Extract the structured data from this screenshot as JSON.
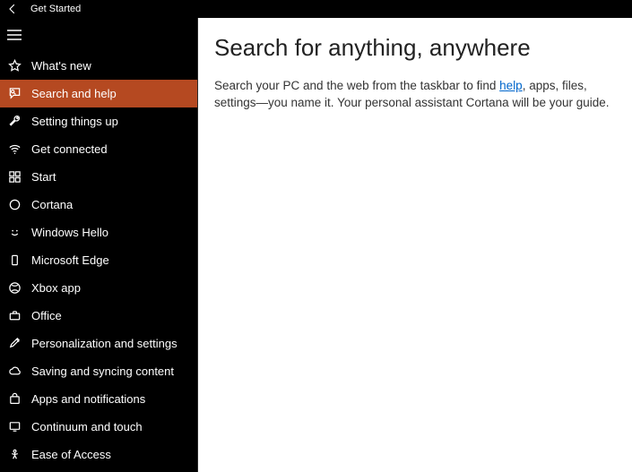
{
  "titlebar": {
    "title": "Get Started"
  },
  "sidebar": {
    "items": [
      {
        "label": "What's new"
      },
      {
        "label": "Search and help"
      },
      {
        "label": "Setting things up"
      },
      {
        "label": "Get connected"
      },
      {
        "label": "Start"
      },
      {
        "label": "Cortana"
      },
      {
        "label": "Windows Hello"
      },
      {
        "label": "Microsoft Edge"
      },
      {
        "label": "Xbox app"
      },
      {
        "label": "Office"
      },
      {
        "label": "Personalization and settings"
      },
      {
        "label": "Saving and syncing content"
      },
      {
        "label": "Apps and notifications"
      },
      {
        "label": "Continuum and touch"
      },
      {
        "label": "Ease of Access"
      }
    ],
    "selectedIndex": 1
  },
  "content": {
    "heading": "Search for anything, anywhere",
    "paragraph_pre": "Search your PC and the web from the taskbar to find ",
    "link_text": "help",
    "paragraph_post": ", apps, files, settings—you name it. Your personal assistant Cortana will be your guide."
  }
}
